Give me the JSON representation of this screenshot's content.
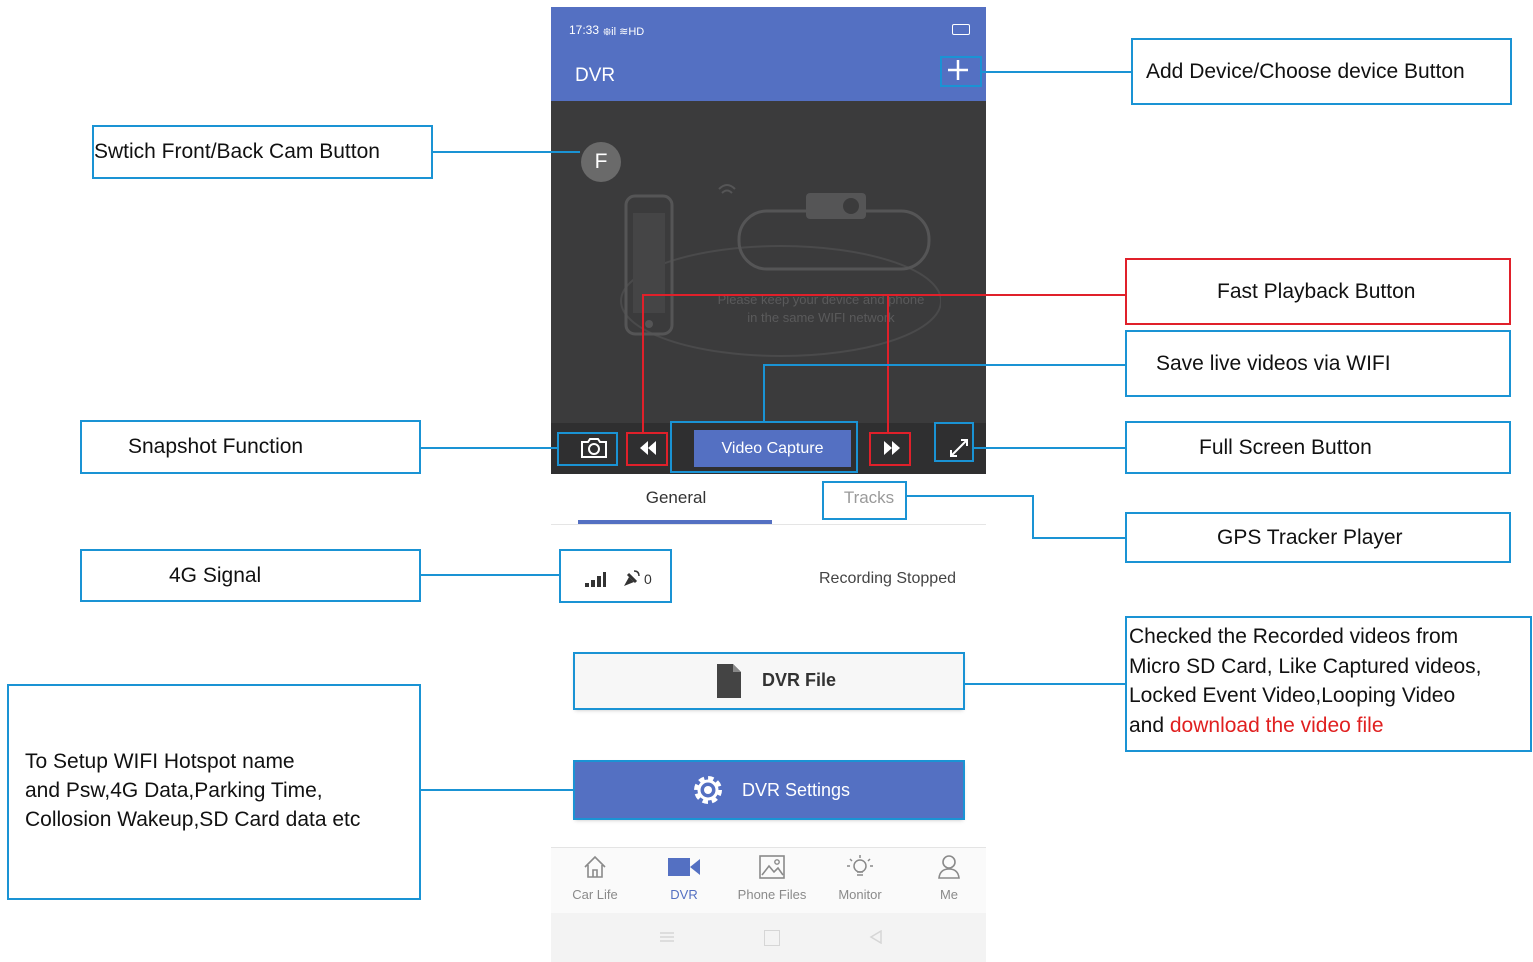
{
  "status": {
    "time": "17:33",
    "signal_text": "᪥il ≋HD",
    "battery_icon": "battery-icon"
  },
  "app": {
    "title": "DVR",
    "add_icon": "plus-icon"
  },
  "video": {
    "cam_button": "F",
    "hint_line1": "Please keep your device and phone",
    "hint_line2": "in the same WIFI network",
    "capture_label": "Video Capture"
  },
  "tabs": {
    "general": "General",
    "tracks": "Tracks"
  },
  "info": {
    "signal_count": "0",
    "record_status": "Recording Stopped"
  },
  "buttons": {
    "dvr_file": "DVR File",
    "dvr_settings": "DVR Settings"
  },
  "bottom_nav": [
    {
      "label": "Car Life",
      "icon": "home-icon"
    },
    {
      "label": "DVR",
      "icon": "video-camera-icon"
    },
    {
      "label": "Phone Files",
      "icon": "image-icon"
    },
    {
      "label": "Monitor",
      "icon": "lightbulb-icon"
    },
    {
      "label": "Me",
      "icon": "person-icon"
    }
  ],
  "annotations": {
    "add_device": "Add Device/Choose device Button",
    "switch_cam": "Swtich Front/Back Cam Button",
    "fast_playback": "Fast Playback Button",
    "save_live": "Save live videos via WIFI",
    "snapshot": "Snapshot Function",
    "full_screen": "Full Screen Button",
    "gps_tracker": "GPS Tracker Player",
    "signal_4g": "4G Signal",
    "recorded_line1": "Checked the Recorded videos from",
    "recorded_line2": "Micro SD Card, Like Captured videos,",
    "recorded_line3": "Locked Event Video,Looping Video",
    "recorded_line4_a": "and ",
    "recorded_line4_b": "download the video file",
    "setup_line1": "To Setup WIFI Hotspot name",
    "setup_line2": "and Psw,4G Data,Parking Time,",
    "setup_line3": "Collosion Wakeup,SD Card data etc"
  },
  "colors": {
    "primary": "#5470c2",
    "annotation_blue": "#1a93d4",
    "annotation_red": "#e0202a"
  }
}
